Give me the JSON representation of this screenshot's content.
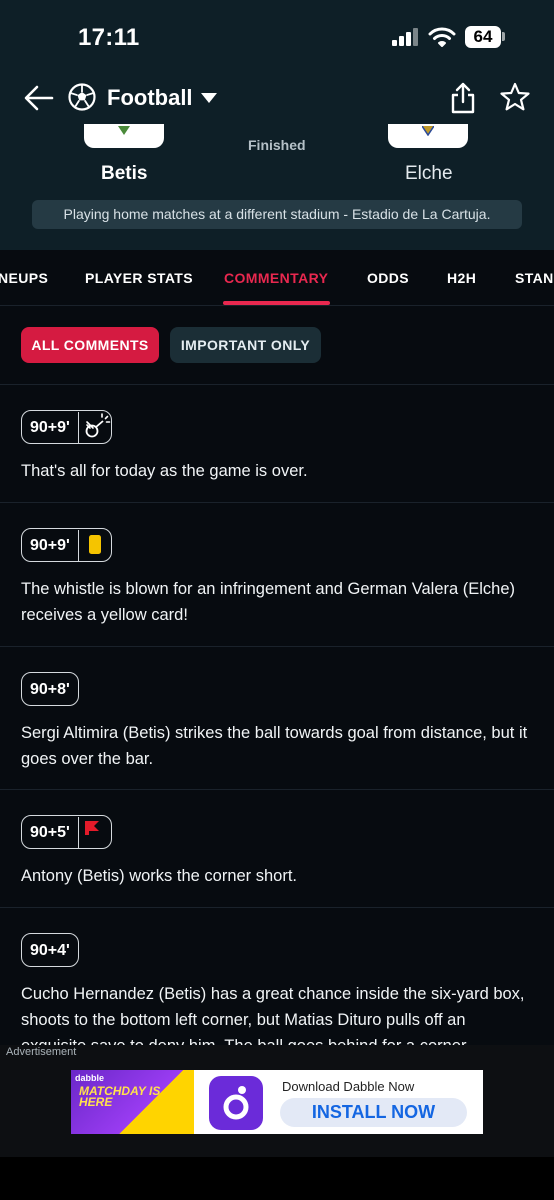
{
  "status_bar": {
    "time": "17:11",
    "battery": "64"
  },
  "nav": {
    "sport": "Football"
  },
  "match": {
    "home_team": "Betis",
    "away_team": "Elche",
    "status": "Finished",
    "venue_note": "Playing home matches at a different stadium - Estadio de La Cartuja."
  },
  "tabs": [
    {
      "label": "NEUPS"
    },
    {
      "label": "PLAYER STATS"
    },
    {
      "label": "COMMENTARY",
      "active": true
    },
    {
      "label": "ODDS"
    },
    {
      "label": "H2H"
    },
    {
      "label": "STAN"
    }
  ],
  "filters": {
    "all": "ALL COMMENTS",
    "important": "IMPORTANT ONLY",
    "selected": "all"
  },
  "commentary": [
    {
      "minute": "90+9'",
      "icon": "whistle-icon",
      "text": "That's all for today as the game is over."
    },
    {
      "minute": "90+9'",
      "icon": "yellow-card-icon",
      "text": "The whistle is blown for an infringement and German Valera (Elche) receives a yellow card!"
    },
    {
      "minute": "90+8'",
      "icon": "",
      "text": "Sergi Altimira (Betis) strikes the ball towards goal from distance, but it goes over the bar."
    },
    {
      "minute": "90+5'",
      "icon": "corner-flag-icon",
      "text": "Antony (Betis) works the corner short."
    },
    {
      "minute": "90+4'",
      "icon": "",
      "text": "Cucho Hernandez (Betis) has a great chance inside the six-yard box, shoots to the bottom left corner, but Matias Dituro pulls off an exquisite save to deny him. The ball goes behind for a corner."
    }
  ],
  "ad": {
    "label": "Advertisement",
    "brand": "dabble",
    "headline": "MATCHDAY IS HERE",
    "title": "Download Dabble Now",
    "cta": "INSTALL NOW"
  },
  "colors": {
    "accent": "#e8284f",
    "header_bg": "#0e1f27",
    "page_bg": "#070b10",
    "yellow_card": "#f5c400"
  }
}
